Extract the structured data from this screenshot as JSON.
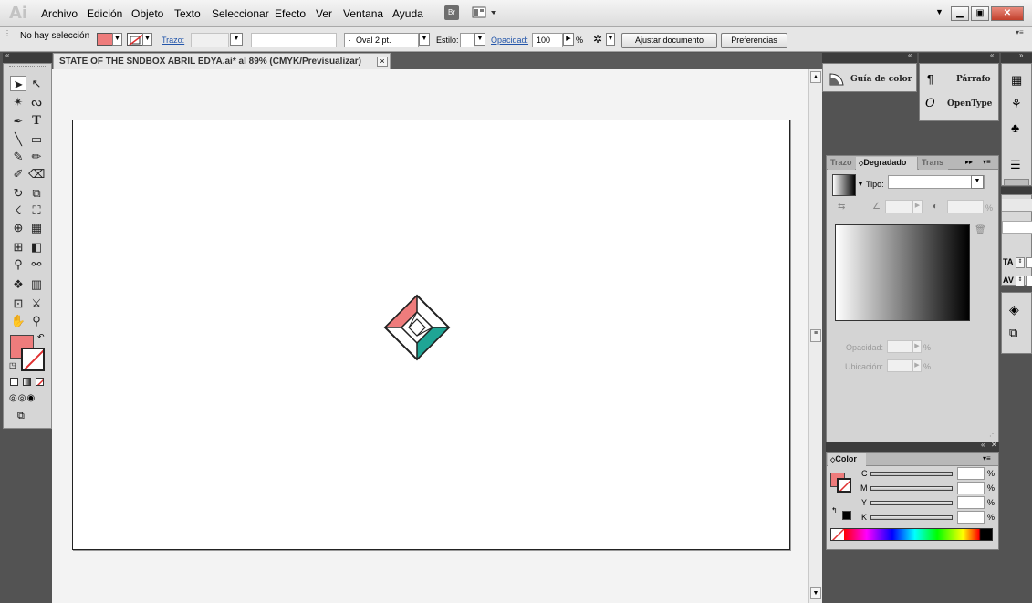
{
  "app": {
    "logo": "Ai"
  },
  "menu": [
    "Archivo",
    "Edición",
    "Objeto",
    "Texto",
    "Seleccionar",
    "Efecto",
    "Ver",
    "Ventana",
    "Ayuda"
  ],
  "toolbar_extra": {
    "bridge": "Br"
  },
  "controlbar": {
    "selection": "No hay selección",
    "trazo_label": "Trazo:",
    "brush": "Oval 2 pt.",
    "estilo_label": "Estilo:",
    "opacidad_label": "Opacidad:",
    "opacidad_value": "100",
    "percent": "%",
    "ajustar": "Ajustar documento",
    "preferencias": "Preferencias"
  },
  "document": {
    "tab_title": "STATE OF THE SNDBOX ABRIL EDYA.ai* al 89% (CMYK/Previsualizar)",
    "close": "×"
  },
  "artwork": {
    "top_color": "#ee7c7c",
    "bottom_color": "#1fa595"
  },
  "panels": {
    "guia_color": "Guía de color",
    "parrafo": "Párrafo",
    "opentype": "OpenType",
    "gradient_tabs": [
      "Trazo",
      "Degradado",
      "Trans"
    ],
    "tipo_label": "Tipo:",
    "opacidad": "Opacidad:",
    "ubicacion": "Ubicación:",
    "color_tab": "Color",
    "cmyk": [
      "C",
      "M",
      "Y",
      "K"
    ],
    "percent": "%"
  },
  "colors": {
    "fill": "#ee7c7c",
    "accent_link": "#2255aa"
  }
}
